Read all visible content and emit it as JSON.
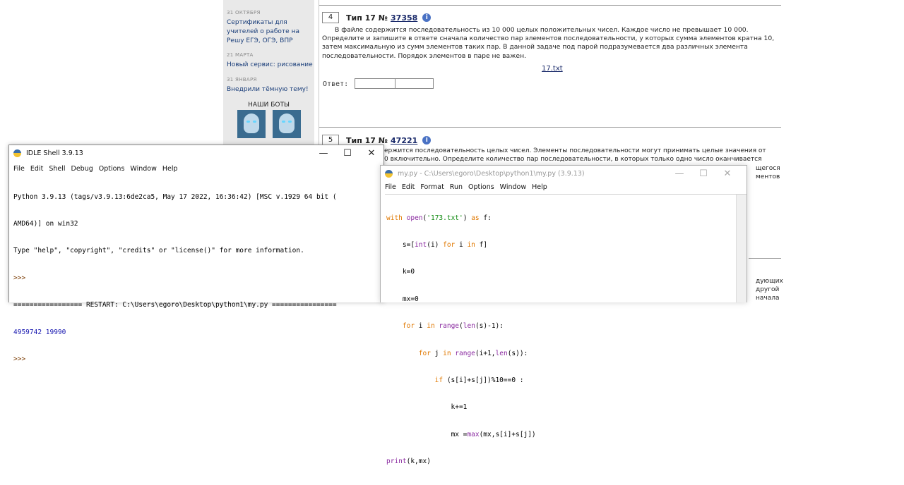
{
  "sidebar": {
    "news": [
      {
        "date": "31 октября",
        "text_lines": [
          "Сертификаты для",
          "учителей о работе на",
          "Решу ЕГЭ, ОГЭ, ВПР"
        ]
      },
      {
        "date": "21 марта",
        "text_lines": [
          "Новый сервис: рисование"
        ]
      },
      {
        "date": "31 января",
        "text_lines": [
          "Внедрили тёмную тему!"
        ]
      }
    ],
    "bots_title": "НАШИ БОТЫ"
  },
  "tasks": [
    {
      "number": "4",
      "type_label": "Тип 17 №",
      "task_id": "37358",
      "lines": [
        "В файле содержится последовательность из 10 000 целых положительных чисел. Каждое число не превышает 10 000.",
        "Определите и запишите в ответе сначала количество пар элементов последовательности, у которых сумма элементов кратна 10,",
        "затем максимальную из сумм элементов таких пар. В данной задаче под парой подразумевается два различных элемента",
        "последовательности. Порядок элементов в паре не важен."
      ],
      "file_link": "17.txt",
      "answer_label": "Ответ:"
    },
    {
      "number": "5",
      "type_label": "Тип 17 №",
      "task_id": "47221",
      "visible_fragments": [
        "ержится последовательность целых чисел. Элементы последовательности могут принимать целые значения от",
        "0 включительно. Определите количество пар последовательности, в которых только одно число оканчивается",
        "щегося",
        "ментов",
        "дующих",
        "другой",
        "начала"
      ]
    }
  ],
  "shell": {
    "title": "IDLE Shell 3.9.13",
    "menu": [
      "File",
      "Edit",
      "Shell",
      "Debug",
      "Options",
      "Window",
      "Help"
    ],
    "lines": [
      {
        "text": "Python 3.9.13 (tags/v3.9.13:6de2ca5, May 17 2022, 16:36:42) [MSC v.1929 64 bit (",
        "kind": "normal"
      },
      {
        "text": "AMD64)] on win32",
        "kind": "normal"
      },
      {
        "text": "Type \"help\", \"copyright\", \"credits\" or \"license()\" for more information.",
        "kind": "normal"
      },
      {
        "text": ">>> ",
        "kind": "prompt"
      },
      {
        "text": "================= RESTART: C:\\Users\\egoro\\Desktop\\python1\\my.py ================",
        "kind": "normal"
      },
      {
        "text": "4959742 19990",
        "kind": "out"
      },
      {
        "text": ">>> ",
        "kind": "prompt"
      }
    ]
  },
  "editor": {
    "title": "my.py - C:\\Users\\egoro\\Desktop\\python1\\my.py (3.9.13)",
    "menu": [
      "File",
      "Edit",
      "Format",
      "Run",
      "Options",
      "Window",
      "Help"
    ],
    "code_lines": [
      "with open('173.txt') as f:",
      "    s=[int(i) for i in f]",
      "    k=0",
      "    mx=0",
      "    for i in range(len(s)-1):",
      "        for j in range(i+1,len(s)):",
      "            if (s[i]+s[j])%10==0 :",
      "                k+=1",
      "                mx =max(mx,s[i]+s[j])",
      "print(k,mx)"
    ]
  },
  "window_controls": {
    "minimize": "—",
    "maximize": "☐",
    "close": "✕"
  },
  "icons": {
    "info": "info-icon",
    "python": "python-icon",
    "bot": "bot-avatar-icon"
  }
}
